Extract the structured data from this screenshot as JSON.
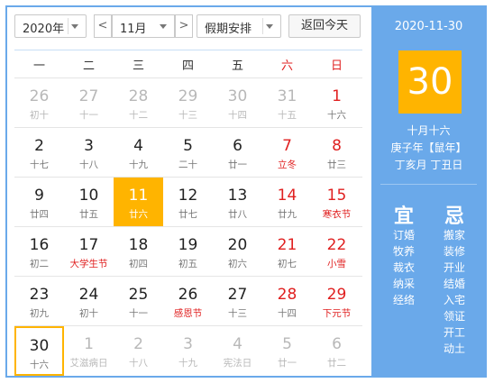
{
  "toolbar": {
    "year": "2020年",
    "month": "11月",
    "holiday": "假期安排",
    "today_btn": "返回今天",
    "prev": "<",
    "next": ">"
  },
  "weekdays": [
    "一",
    "二",
    "三",
    "四",
    "五",
    "六",
    "日"
  ],
  "weeks": [
    [
      {
        "d": "26",
        "l": "初十",
        "t": "other"
      },
      {
        "d": "27",
        "l": "十一",
        "t": "other"
      },
      {
        "d": "28",
        "l": "十二",
        "t": "other"
      },
      {
        "d": "29",
        "l": "十三",
        "t": "other"
      },
      {
        "d": "30",
        "l": "十四",
        "t": "other"
      },
      {
        "d": "31",
        "l": "十五",
        "t": "other"
      },
      {
        "d": "1",
        "l": "十六",
        "t": "weekend"
      }
    ],
    [
      {
        "d": "2",
        "l": "十七",
        "t": ""
      },
      {
        "d": "3",
        "l": "十八",
        "t": ""
      },
      {
        "d": "4",
        "l": "十九",
        "t": ""
      },
      {
        "d": "5",
        "l": "二十",
        "t": ""
      },
      {
        "d": "6",
        "l": "廿一",
        "t": ""
      },
      {
        "d": "7",
        "l": "立冬",
        "t": "weekend fest"
      },
      {
        "d": "8",
        "l": "廿三",
        "t": "weekend"
      }
    ],
    [
      {
        "d": "9",
        "l": "廿四",
        "t": ""
      },
      {
        "d": "10",
        "l": "廿五",
        "t": ""
      },
      {
        "d": "11",
        "l": "廿六",
        "t": "sel"
      },
      {
        "d": "12",
        "l": "廿七",
        "t": ""
      },
      {
        "d": "13",
        "l": "廿八",
        "t": ""
      },
      {
        "d": "14",
        "l": "廿九",
        "t": "weekend"
      },
      {
        "d": "15",
        "l": "寒衣节",
        "t": "weekend fest"
      }
    ],
    [
      {
        "d": "16",
        "l": "初二",
        "t": ""
      },
      {
        "d": "17",
        "l": "大学生节",
        "t": "fest"
      },
      {
        "d": "18",
        "l": "初四",
        "t": ""
      },
      {
        "d": "19",
        "l": "初五",
        "t": ""
      },
      {
        "d": "20",
        "l": "初六",
        "t": ""
      },
      {
        "d": "21",
        "l": "初七",
        "t": "weekend"
      },
      {
        "d": "22",
        "l": "小雪",
        "t": "weekend fest"
      }
    ],
    [
      {
        "d": "23",
        "l": "初九",
        "t": ""
      },
      {
        "d": "24",
        "l": "初十",
        "t": ""
      },
      {
        "d": "25",
        "l": "十一",
        "t": ""
      },
      {
        "d": "26",
        "l": "感恩节",
        "t": "fest"
      },
      {
        "d": "27",
        "l": "十三",
        "t": ""
      },
      {
        "d": "28",
        "l": "十四",
        "t": "weekend"
      },
      {
        "d": "29",
        "l": "下元节",
        "t": "weekend fest"
      }
    ],
    [
      {
        "d": "30",
        "l": "十六",
        "t": "today"
      },
      {
        "d": "1",
        "l": "艾滋病日",
        "t": "other"
      },
      {
        "d": "2",
        "l": "十八",
        "t": "other"
      },
      {
        "d": "3",
        "l": "十九",
        "t": "other"
      },
      {
        "d": "4",
        "l": "宪法日",
        "t": "other"
      },
      {
        "d": "5",
        "l": "廿一",
        "t": "other"
      },
      {
        "d": "6",
        "l": "廿二",
        "t": "other"
      }
    ]
  ],
  "panel": {
    "date": "2020-11-30",
    "day": "30",
    "lunar": "十月十六",
    "ganzhi_year": "庚子年【鼠年】",
    "ganzhi_monthday": "丁亥月 丁丑日",
    "yi_title": "宜",
    "ji_title": "忌",
    "yi": [
      "订婚",
      "牧养",
      "裁衣",
      "纳采",
      "经络"
    ],
    "ji": [
      "搬家",
      "装修",
      "开业",
      "结婚",
      "入宅",
      "领证",
      "开工",
      "动土"
    ]
  },
  "colors": {
    "accent": "#6aa9ea",
    "highlight": "#ffb400",
    "holiday_red": "#e02020"
  }
}
